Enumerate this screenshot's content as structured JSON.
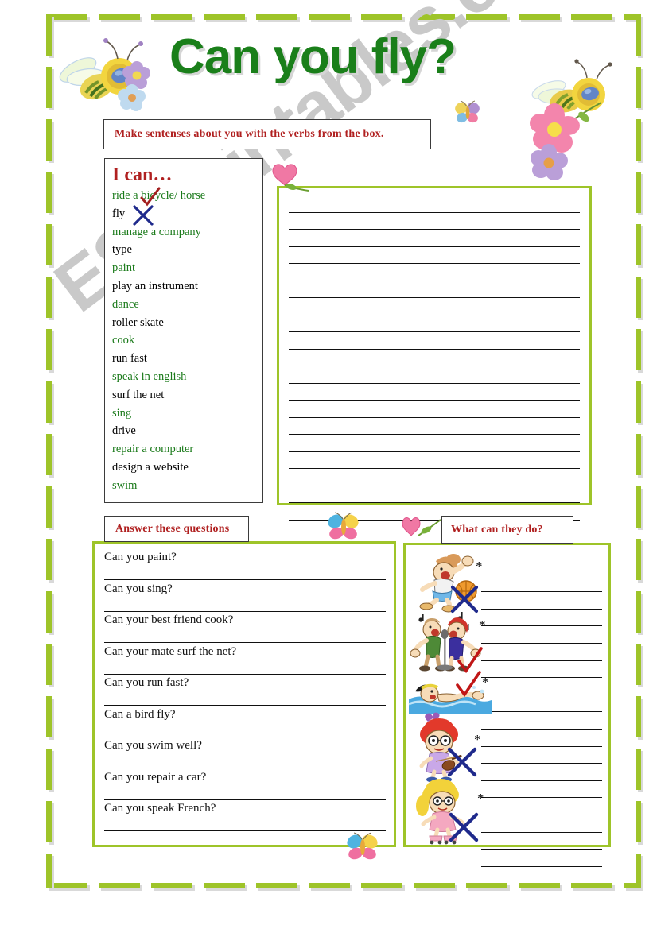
{
  "title": "Can you fly?",
  "watermark": "ESLprintables.com",
  "colors": {
    "title_green": "#1a7f1a",
    "frame_green": "#9ec429",
    "box_green": "#9ec429",
    "header_red": "#b02020",
    "verb_green": "#1a7a1a",
    "verb_black": "#000000",
    "tick_red": "#b02020",
    "cross_blue": "#1f2a8c"
  },
  "instruction": {
    "text": "Make sentenses about you with the verbs from the box."
  },
  "verb_box": {
    "heading": "I can…",
    "items": [
      {
        "label": "ride a bicycle/ horse",
        "color": "green",
        "mark": "tick"
      },
      {
        "label": "fly",
        "color": "black",
        "mark": "cross"
      },
      {
        "label": "manage a company",
        "color": "green",
        "mark": ""
      },
      {
        "label": "type",
        "color": "black",
        "mark": ""
      },
      {
        "label": "paint",
        "color": "green",
        "mark": ""
      },
      {
        "label": "play an instrument",
        "color": "black",
        "mark": ""
      },
      {
        "label": "dance",
        "color": "green",
        "mark": ""
      },
      {
        "label": "roller skate",
        "color": "black",
        "mark": ""
      },
      {
        "label": "cook",
        "color": "green",
        "mark": ""
      },
      {
        "label": "run fast",
        "color": "black",
        "mark": ""
      },
      {
        "label": "speak in english",
        "color": "green",
        "mark": ""
      },
      {
        "label": "surf the net",
        "color": "black",
        "mark": ""
      },
      {
        "label": "sing",
        "color": "green",
        "mark": ""
      },
      {
        "label": "drive",
        "color": "black",
        "mark": ""
      },
      {
        "label": "repair a computer",
        "color": "green",
        "mark": ""
      },
      {
        "label": "design a website",
        "color": "black",
        "mark": ""
      },
      {
        "label": "swim",
        "color": "green",
        "mark": ""
      }
    ]
  },
  "writing_box": {
    "line_count": 19
  },
  "answer_section": {
    "header": "Answer these questions",
    "questions": [
      "Can you paint?",
      "Can you sing?",
      "Can your best friend cook?",
      "Can your mate surf the net?",
      "Can you run fast?",
      "Can a bird fly?",
      "Can you swim well?",
      "Can you repair a car?",
      "Can you speak French?"
    ]
  },
  "what_section": {
    "header": "What can they do?",
    "line_count": 18,
    "bullet": "*",
    "bullet_count": 5,
    "pictures": [
      {
        "name": "boy-playing-basketball",
        "mark": "cross"
      },
      {
        "name": "couple-singing-karaoke",
        "mark": "tick"
      },
      {
        "name": "girl-swimming",
        "mark": "tick"
      },
      {
        "name": "girl-playing-violin",
        "mark": "cross"
      },
      {
        "name": "girl-roller-skating",
        "mark": "cross"
      }
    ]
  },
  "decorations": [
    {
      "name": "bee-with-flowers-left"
    },
    {
      "name": "bee-with-flowers-right"
    },
    {
      "name": "small-butterfly-title"
    },
    {
      "name": "heart-flower-upper"
    },
    {
      "name": "butterfly-middle"
    },
    {
      "name": "heart-flower-lower"
    },
    {
      "name": "butterfly-bottom"
    }
  ]
}
